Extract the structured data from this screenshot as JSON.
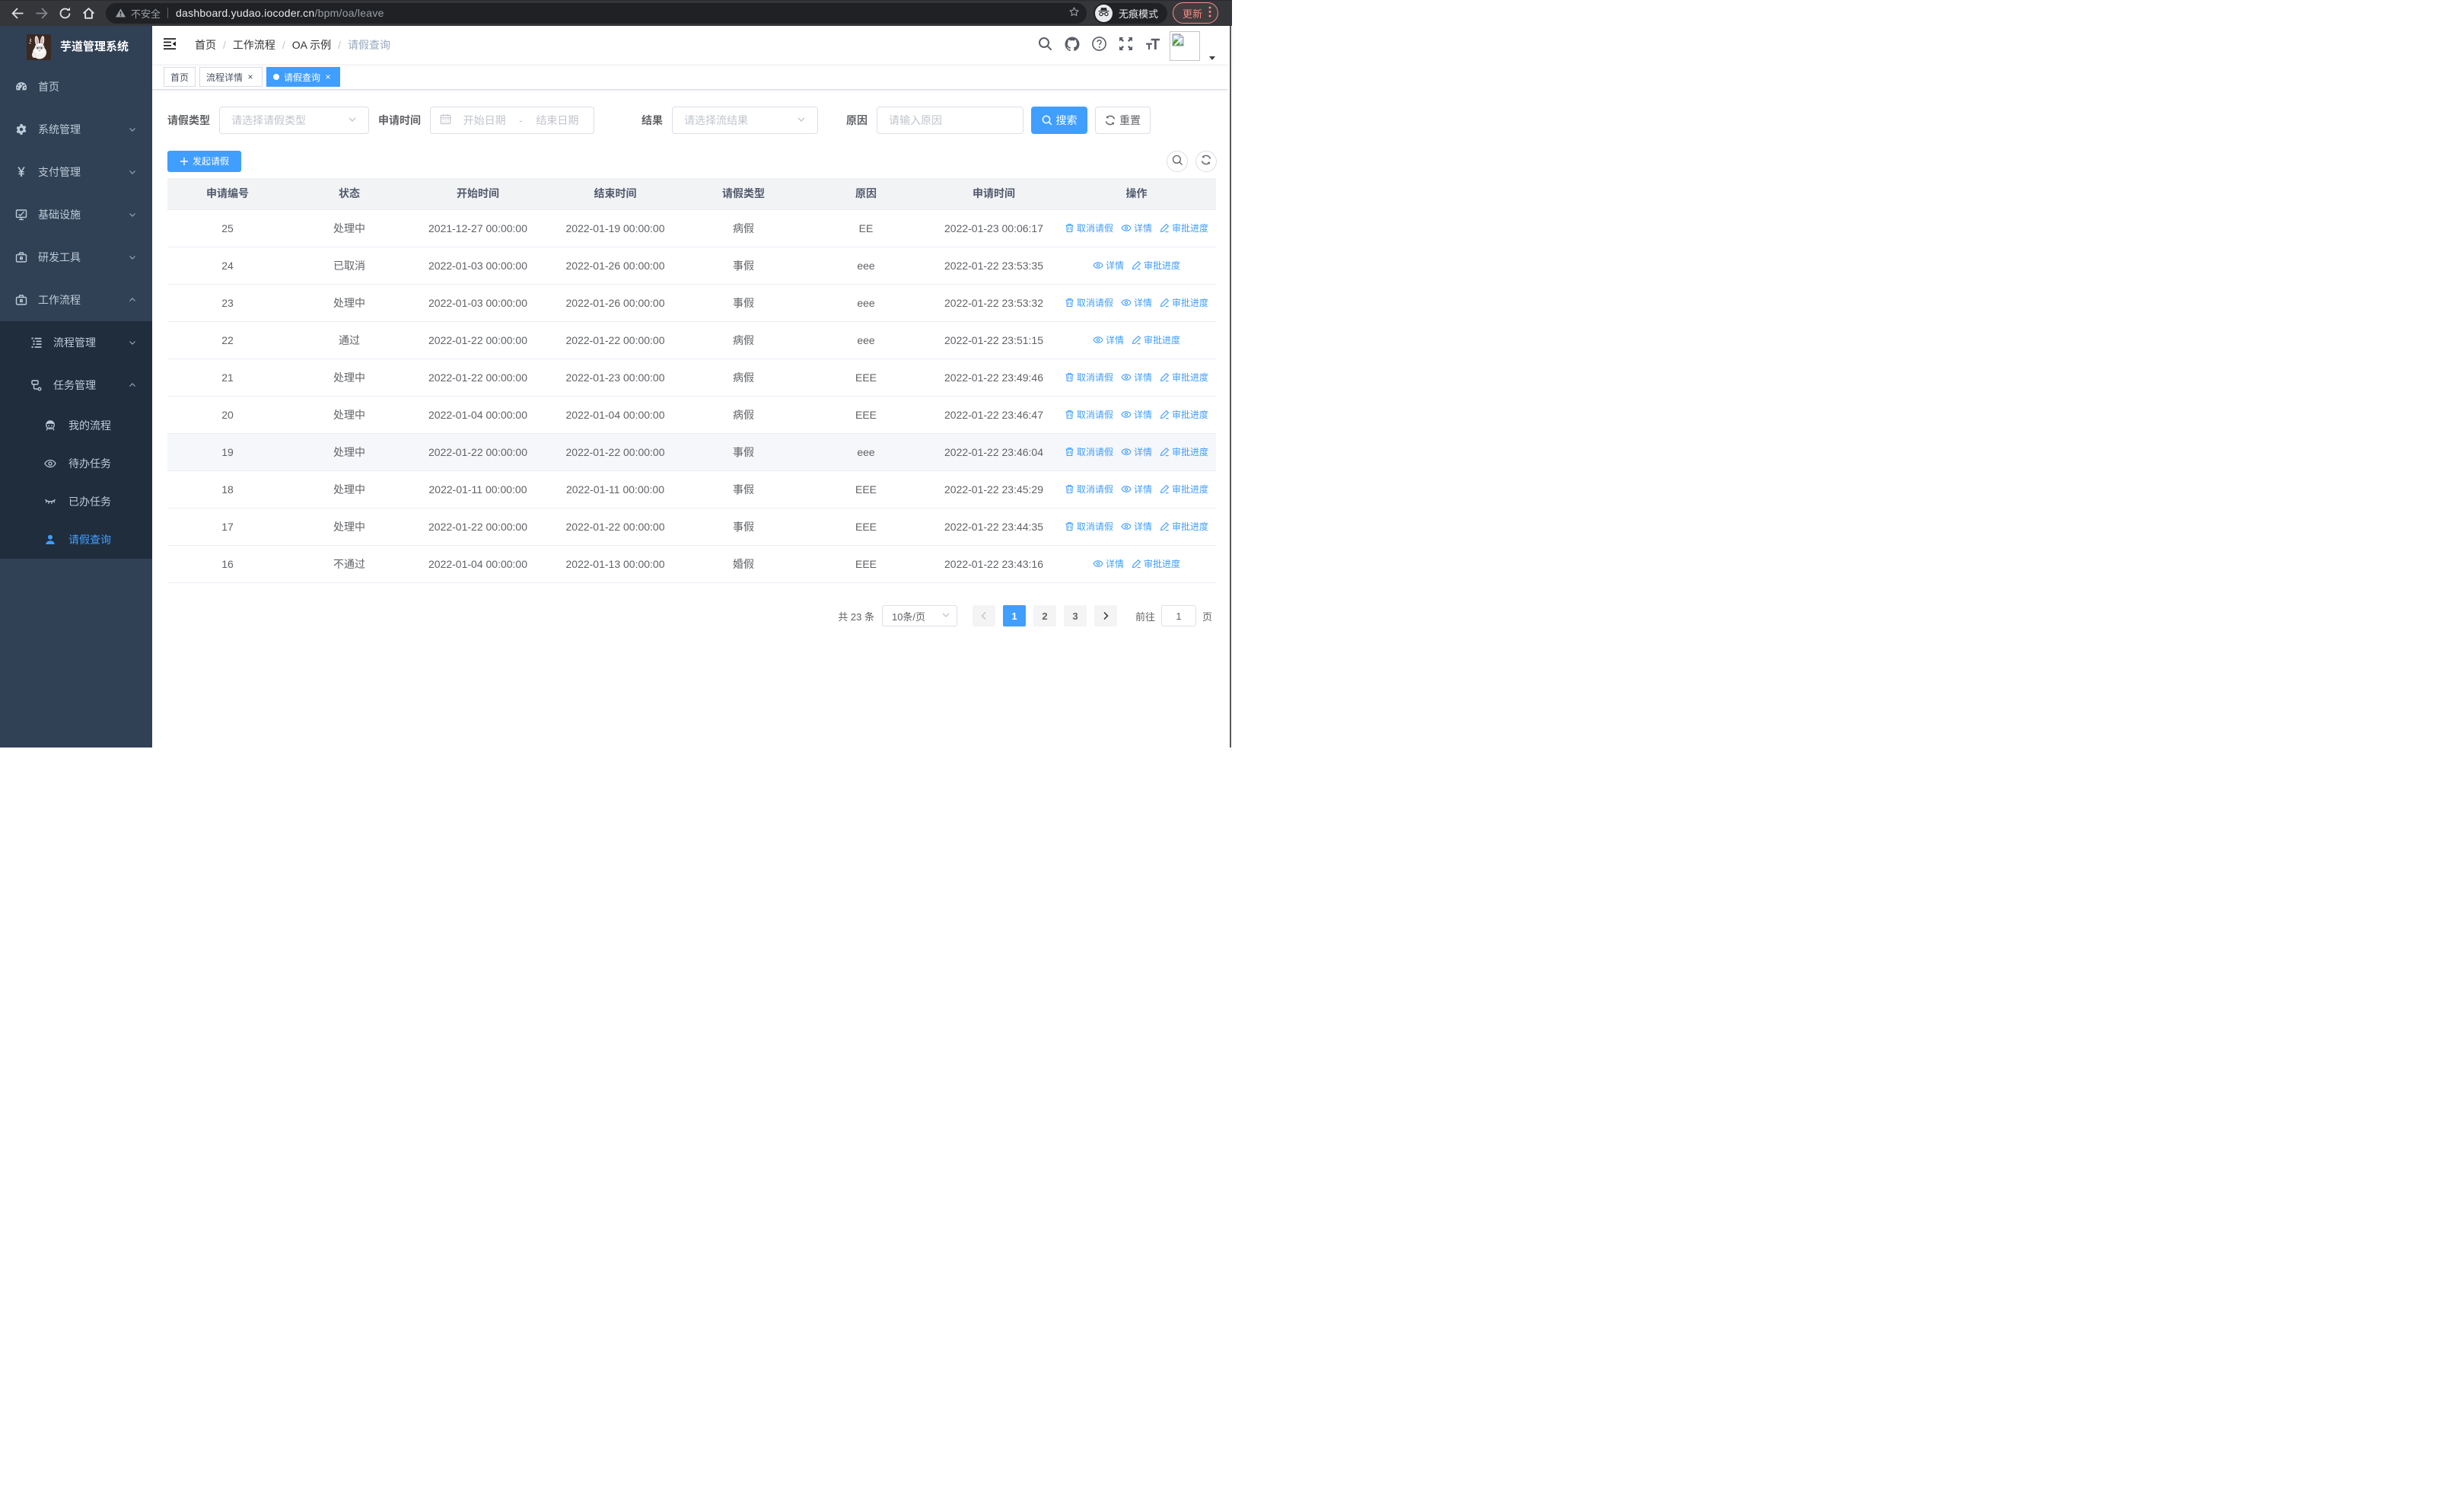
{
  "chrome": {
    "security_label": "不安全",
    "url_host": "dashboard.yudao.iocoder.cn",
    "url_path": "/bpm/oa/leave",
    "incognito_label": "无痕模式",
    "update_label": "更新"
  },
  "sidebar": {
    "logo_title": "芋道管理系统",
    "items": [
      {
        "icon": "dashboard-icon",
        "label": "首页",
        "type": "item"
      },
      {
        "icon": "gear-icon",
        "label": "系统管理",
        "type": "sub",
        "arrow": "down"
      },
      {
        "icon": "yuan-icon",
        "label": "支付管理",
        "type": "sub",
        "arrow": "down"
      },
      {
        "icon": "monitor-icon",
        "label": "基础设施",
        "type": "sub",
        "arrow": "down"
      },
      {
        "icon": "briefcase-icon",
        "label": "研发工具",
        "type": "sub",
        "arrow": "down"
      },
      {
        "icon": "briefcase-icon",
        "label": "工作流程",
        "type": "sub",
        "arrow": "up",
        "children": [
          {
            "icon": "tree-list-icon",
            "label": "流程管理",
            "type": "sub",
            "arrow": "down"
          },
          {
            "icon": "flow-node-icon",
            "label": "任务管理",
            "type": "sub",
            "arrow": "up",
            "children": [
              {
                "icon": "robot-icon",
                "label": "我的流程",
                "type": "leaf"
              },
              {
                "icon": "eye-open-icon",
                "label": "待办任务",
                "type": "leaf"
              },
              {
                "icon": "eye-closed-icon",
                "label": "已办任务",
                "type": "leaf"
              },
              {
                "icon": "user-icon",
                "label": "请假查询",
                "type": "leaf",
                "active": true
              }
            ]
          }
        ]
      }
    ]
  },
  "navbar": {
    "breadcrumb": [
      {
        "label": "首页"
      },
      {
        "label": "工作流程"
      },
      {
        "label": "OA 示例"
      },
      {
        "label": "请假查询",
        "current": true
      }
    ],
    "tools": [
      "search-icon",
      "github-icon",
      "question-icon",
      "fullscreen-icon",
      "font-size-icon"
    ]
  },
  "tags": [
    {
      "label": "首页",
      "active": false,
      "closable": false
    },
    {
      "label": "流程详情",
      "active": false,
      "closable": true
    },
    {
      "label": "请假查询",
      "active": true,
      "closable": true
    }
  ],
  "filter": {
    "leave_type_label": "请假类型",
    "leave_type_placeholder": "请选择请假类型",
    "apply_time_label": "申请时间",
    "date_start_placeholder": "开始日期",
    "date_separator": "-",
    "date_end_placeholder": "结束日期",
    "result_label": "结果",
    "result_placeholder": "请选择流结果",
    "reason_label": "原因",
    "reason_placeholder": "请输入原因",
    "search_label": "搜索",
    "reset_label": "重置"
  },
  "toolbar": {
    "create_label": "发起请假"
  },
  "table": {
    "columns": [
      "申请编号",
      "状态",
      "开始时间",
      "结束时间",
      "请假类型",
      "原因",
      "申请时间",
      "操作"
    ],
    "rows": [
      {
        "id": "25",
        "status": "处理中",
        "start": "2021-12-27 00:00:00",
        "end": "2022-01-19 00:00:00",
        "type": "病假",
        "reason": "EE",
        "applied": "2022-01-23 00:06:17",
        "ops": [
          "cancel",
          "detail",
          "progress"
        ],
        "hover": false
      },
      {
        "id": "24",
        "status": "已取消",
        "start": "2022-01-03 00:00:00",
        "end": "2022-01-26 00:00:00",
        "type": "事假",
        "reason": "eee",
        "applied": "2022-01-22 23:53:35",
        "ops": [
          "detail",
          "progress"
        ],
        "hover": false
      },
      {
        "id": "23",
        "status": "处理中",
        "start": "2022-01-03 00:00:00",
        "end": "2022-01-26 00:00:00",
        "type": "事假",
        "reason": "eee",
        "applied": "2022-01-22 23:53:32",
        "ops": [
          "cancel",
          "detail",
          "progress"
        ],
        "hover": false
      },
      {
        "id": "22",
        "status": "通过",
        "start": "2022-01-22 00:00:00",
        "end": "2022-01-22 00:00:00",
        "type": "病假",
        "reason": "eee",
        "applied": "2022-01-22 23:51:15",
        "ops": [
          "detail",
          "progress"
        ],
        "hover": false
      },
      {
        "id": "21",
        "status": "处理中",
        "start": "2022-01-22 00:00:00",
        "end": "2022-01-23 00:00:00",
        "type": "病假",
        "reason": "EEE",
        "applied": "2022-01-22 23:49:46",
        "ops": [
          "cancel",
          "detail",
          "progress"
        ],
        "hover": false
      },
      {
        "id": "20",
        "status": "处理中",
        "start": "2022-01-04 00:00:00",
        "end": "2022-01-04 00:00:00",
        "type": "病假",
        "reason": "EEE",
        "applied": "2022-01-22 23:46:47",
        "ops": [
          "cancel",
          "detail",
          "progress"
        ],
        "hover": false
      },
      {
        "id": "19",
        "status": "处理中",
        "start": "2022-01-22 00:00:00",
        "end": "2022-01-22 00:00:00",
        "type": "事假",
        "reason": "eee",
        "applied": "2022-01-22 23:46:04",
        "ops": [
          "cancel",
          "detail",
          "progress"
        ],
        "hover": true
      },
      {
        "id": "18",
        "status": "处理中",
        "start": "2022-01-11 00:00:00",
        "end": "2022-01-11 00:00:00",
        "type": "事假",
        "reason": "EEE",
        "applied": "2022-01-22 23:45:29",
        "ops": [
          "cancel",
          "detail",
          "progress"
        ],
        "hover": false
      },
      {
        "id": "17",
        "status": "处理中",
        "start": "2022-01-22 00:00:00",
        "end": "2022-01-22 00:00:00",
        "type": "事假",
        "reason": "EEE",
        "applied": "2022-01-22 23:44:35",
        "ops": [
          "cancel",
          "detail",
          "progress"
        ],
        "hover": false
      },
      {
        "id": "16",
        "status": "不通过",
        "start": "2022-01-04 00:00:00",
        "end": "2022-01-13 00:00:00",
        "type": "婚假",
        "reason": "EEE",
        "applied": "2022-01-22 23:43:16",
        "ops": [
          "detail",
          "progress"
        ],
        "hover": false
      }
    ],
    "op_labels": {
      "cancel": "取消请假",
      "detail": "详情",
      "progress": "审批进度"
    }
  },
  "pagination": {
    "total_label": "共 23 条",
    "page_size_label": "10条/页",
    "pages": [
      "1",
      "2",
      "3"
    ],
    "active_page": "1",
    "jump_prefix": "前往",
    "jump_value": "1",
    "jump_suffix": "页"
  },
  "colors": {
    "accent": "#409eff",
    "sidebar_bg": "#304156",
    "submenu_bg": "#1f2d3d",
    "chrome_bg": "#35363a",
    "omnibox_bg": "#202124",
    "update_accent": "#f28b82"
  }
}
